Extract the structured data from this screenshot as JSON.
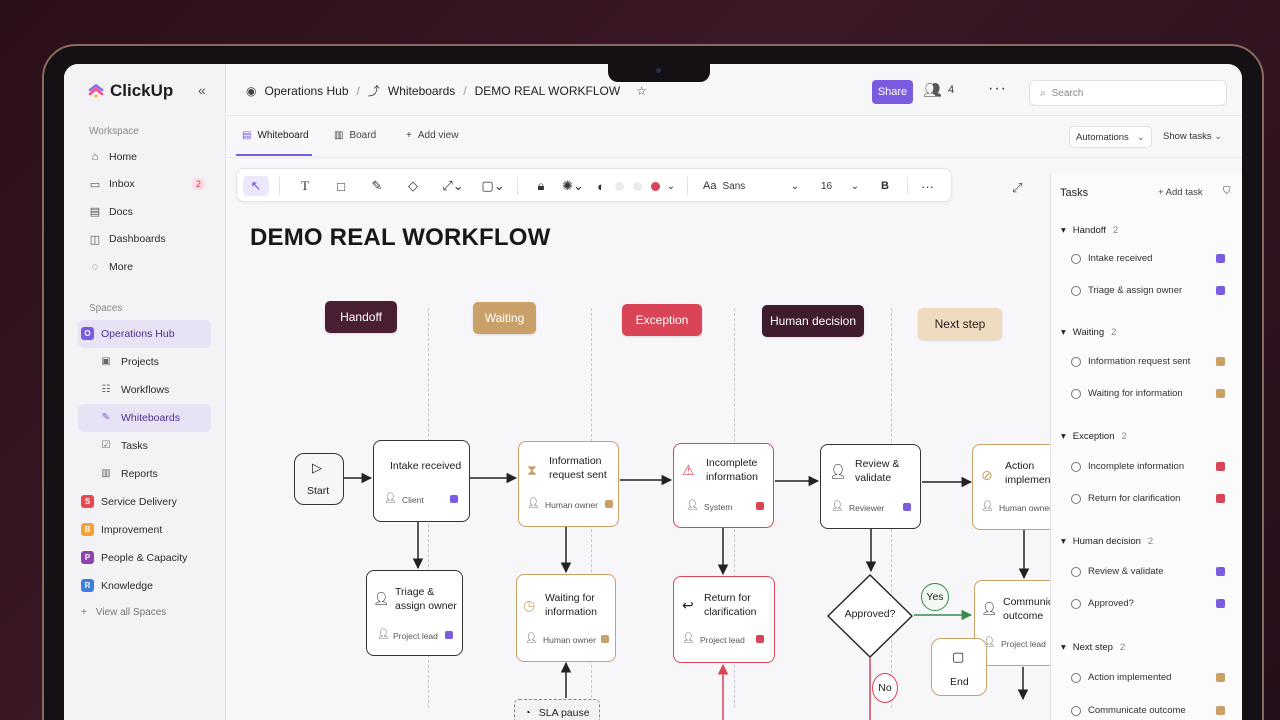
{
  "app": {
    "name": "ClickUp"
  },
  "sidebar": {
    "workspace_label": "Workspace",
    "nav": [
      {
        "label": "Home",
        "icon": "home-icon"
      },
      {
        "label": "Inbox",
        "icon": "inbox-icon",
        "badge": "2"
      },
      {
        "label": "Docs",
        "icon": "docs-icon"
      },
      {
        "label": "Dashboards",
        "icon": "dashboard-icon"
      },
      {
        "label": "More",
        "icon": "more-icon"
      }
    ],
    "spaces_label": "Spaces",
    "spaces": [
      {
        "label": "Operations Hub",
        "letter": "O",
        "color": "#7b5ce0"
      },
      {
        "label": "Service Delivery",
        "letter": "S",
        "color": "#e5484d"
      },
      {
        "label": "Improvement",
        "letter": "B",
        "color": "#f2a23a"
      },
      {
        "label": "People & Capacity",
        "letter": "P",
        "color": "#8e44ad"
      },
      {
        "label": "Knowledge",
        "letter": "R",
        "color": "#3b7ddd"
      }
    ],
    "sub_items": [
      "Projects",
      "Workflows",
      "Whiteboards",
      "Tasks",
      "Reports"
    ],
    "view_all": "View all Spaces"
  },
  "breadcrumb": {
    "space": "Operations Hub",
    "section": "Whiteboards",
    "page": "DEMO REAL WORKFLOW"
  },
  "header": {
    "share": "Share",
    "members_count": "4",
    "search_placeholder": "Search"
  },
  "tabs": {
    "whiteboard": "Whiteboard",
    "board": "Board",
    "add_view": "Add view",
    "automations": "Automations",
    "show_tasks": "Show tasks"
  },
  "toolbar": {
    "font_label": "Aa",
    "font": "Sans",
    "font_size": "16",
    "bold": "B",
    "more": "···"
  },
  "board": {
    "title": "DEMO REAL WORKFLOW",
    "lanes": [
      {
        "label": "Handoff",
        "bg": "#4a1f34",
        "fg": "#ffffff"
      },
      {
        "label": "Waiting",
        "bg": "#c9a068",
        "fg": "#ffffff"
      },
      {
        "label": "Exception",
        "bg": "#d94457",
        "fg": "#ffffff"
      },
      {
        "label": "Human decision",
        "bg": "#3e1b2e",
        "fg": "#ffffff"
      },
      {
        "label": "Next step",
        "bg": "#efdcc0",
        "fg": "#2b2220"
      }
    ],
    "start": "Start",
    "end": "End",
    "nodes": {
      "intake": {
        "title": "Intake received",
        "owner": "Client"
      },
      "triage": {
        "title": "Triage & assign owner",
        "owner": "Project lead"
      },
      "info_request": {
        "title": "Information request sent",
        "owner": "Human owner"
      },
      "waiting_info": {
        "title": "Waiting for information",
        "owner": "Human owner"
      },
      "incomplete": {
        "title": "Incomplete information",
        "owner": "System"
      },
      "clarification": {
        "title": "Return for clarification",
        "owner": "Project lead"
      },
      "review": {
        "title": "Review & validate",
        "owner": "Reviewer"
      },
      "approved": {
        "title": "Approved?"
      },
      "action": {
        "title": "Action implemented",
        "owner": "Human owner"
      },
      "communicate": {
        "title": "Communicate outcome",
        "owner": "Project lead"
      }
    },
    "sla": "SLA pause",
    "yes": "Yes",
    "no": "No"
  },
  "tasks_panel": {
    "title": "Tasks",
    "add": "Add task",
    "groups": [
      {
        "name": "Handoff",
        "count": "2",
        "items": [
          {
            "label": "Intake received",
            "color": "#7b5ce0"
          },
          {
            "label": "Triage & assign owner",
            "color": "#7b5ce0"
          }
        ]
      },
      {
        "name": "Waiting",
        "count": "2",
        "items": [
          {
            "label": "Information request sent",
            "color": "#c9a068"
          },
          {
            "label": "Waiting for information",
            "color": "#c9a068"
          }
        ]
      },
      {
        "name": "Exception",
        "count": "2",
        "items": [
          {
            "label": "Incomplete information",
            "color": "#d94457"
          },
          {
            "label": "Return for clarification",
            "color": "#d94457"
          }
        ]
      },
      {
        "name": "Human decision",
        "count": "2",
        "items": [
          {
            "label": "Review & validate",
            "color": "#7b5ce0"
          },
          {
            "label": "Approved?",
            "color": "#7b5ce0"
          }
        ]
      },
      {
        "name": "Next step",
        "count": "2",
        "items": [
          {
            "label": "Action implemented",
            "color": "#c9a068"
          },
          {
            "label": "Communicate outcome",
            "color": "#c9a068"
          }
        ]
      }
    ]
  }
}
